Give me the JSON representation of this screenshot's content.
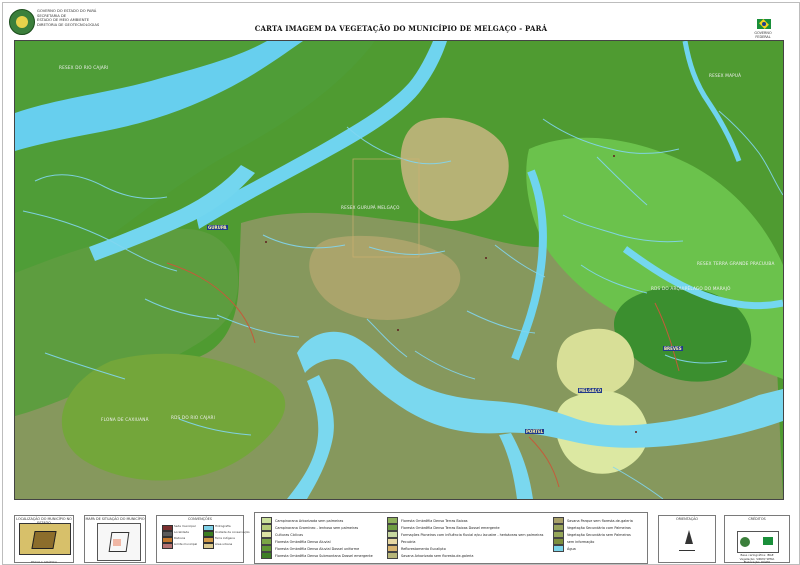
{
  "header": {
    "org_lines": [
      "GOVERNO DO ESTADO DO PARÁ",
      "SECRETARIA DE",
      "ESTADO DE MEIO AMBIENTE",
      "DIRETORIA DE GEOTECNOLOGIAS"
    ],
    "title": "CARTA IMAGEM DA VEGETAÇÃO DO MUNICÍPIO DE MELGAÇO - PARÁ",
    "flag_caption": "GOVERNO FEDERAL",
    "flag_colors": {
      "green": "#1a8f3a",
      "yellow": "#f2d21e",
      "blue": "#1f3f8f"
    }
  },
  "map_labels": [
    "RESEX DO RIO CAJARI",
    "RESEX MAPUÁ",
    "RESEX GURUPÁ MELGAÇO",
    "RESEX TERRA GRANDE PRACUUBA",
    "RDS DO RIO CAJARI",
    "RDS DO ARQUIPÉLAGO DO MARAJÓ",
    "FLONA DE CAXIUANÃ"
  ],
  "towns": [
    "GURUPÁ",
    "BREVES",
    "MELGAÇO",
    "PORTEL"
  ],
  "legend_titles": {
    "locator": "LOCALIZAÇÃO DO MUNICÍPIO NO ESTADO",
    "state_map": "MAPA DE SITUAÇÃO DO MUNICÍPIO",
    "conventions": "CONVENÇÕES",
    "orientation": "ORIENTAÇÃO",
    "credits": "CRÉDITOS"
  },
  "locator_caption": "ESCALA GRÁFICA",
  "conventions": [
    {
      "label": "Sede municipal",
      "color": "#7a2f2f"
    },
    {
      "label": "Localidade",
      "color": "#5b5b5b"
    },
    {
      "label": "Rodovia",
      "color": "#c4782e"
    },
    {
      "label": "Limite municipal",
      "color": "#b57272"
    },
    {
      "label": "Hidrografia",
      "color": "#7fd1e8"
    },
    {
      "label": "Unidade de conservação",
      "color": "#3c7e21"
    },
    {
      "label": "Terra indígena",
      "color": "#d19a49"
    },
    {
      "label": "Área urbana",
      "color": "#dac98f"
    }
  ],
  "vegetation_legend": [
    {
      "label": "Campinarana Arborizada sem palmeiras",
      "color": "#cbe09c"
    },
    {
      "label": "Campinarana Gramíneo - lenhosa sem palmeiras",
      "color": "#b6cc7a"
    },
    {
      "label": "Culturas Cíclicas",
      "color": "#dde2a5"
    },
    {
      "label": "Floresta Ombrófila Densa Aluvial",
      "color": "#7aa546"
    },
    {
      "label": "Floresta Ombrófila Densa Aluvial Dossel uniforme",
      "color": "#5f9732"
    },
    {
      "label": "Floresta Ombrófila Densa Submontana Dossel emergente",
      "color": "#3e7e25"
    },
    {
      "label": "Floresta Ombrófila Densa Terras Baixas",
      "color": "#8fb15c"
    },
    {
      "label": "Floresta Ombrófila Densa Terras Baixas Dossel emergente",
      "color": "#6f9d43"
    },
    {
      "label": "Formações Pioneiras com influência fluvial e/ou lacustre - herbáceas sem palmeiras",
      "color": "#c8d8a0"
    },
    {
      "label": "Pecuária",
      "color": "#e8d8a3"
    },
    {
      "label": "Reflorestamento Eucalipto",
      "color": "#d8b470"
    },
    {
      "label": "Savana Arborizada sem floresta-de-galeria",
      "color": "#b7b67a"
    },
    {
      "label": "Savana Parque sem floresta-de-galeria",
      "color": "#a8a069"
    },
    {
      "label": "Vegetação Secundária com Palmeiras",
      "color": "#98a35b"
    },
    {
      "label": "Vegetação Secundária sem Palmeiras",
      "color": "#96a75a"
    },
    {
      "label": "sem informação",
      "color": "#7d8f3d"
    },
    {
      "label": "Água",
      "color": "#7bd5ea"
    }
  ],
  "credits_lines": [
    "Base cartográfica: IBGE",
    "Vegetação: SIPAM/ SEMA",
    "Elaboração: DIGEO"
  ]
}
